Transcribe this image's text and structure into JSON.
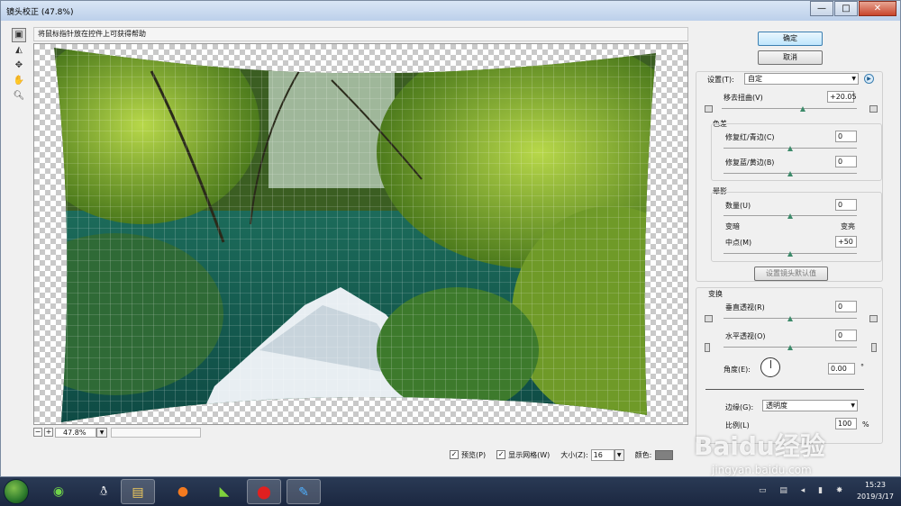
{
  "window": {
    "title": "镜头校正 (47.8%)",
    "min": "—",
    "max": "□",
    "close": "✕"
  },
  "hint": "将鼠标指针放在控件上可获得帮助",
  "tools": [
    "distortion-tool-icon",
    "straighten-icon",
    "move-grid-icon",
    "hand-icon",
    "zoom-icon"
  ],
  "zoom": {
    "minus": "−",
    "plus": "+",
    "value": "47.8%"
  },
  "options": {
    "preview": "预览(P)",
    "show_grid": "显示网格(W)",
    "size_label": "大小(Z):",
    "size_value": "16",
    "color_label": "颜色:"
  },
  "buttons": {
    "ok": "确定",
    "cancel": "取消",
    "set_default": "设置镜头默认值"
  },
  "settings": {
    "label": "设置(T):",
    "value": "自定"
  },
  "distortion": {
    "label": "移去扭曲(V)",
    "value": "+20.05"
  },
  "chromatic": {
    "title": "色差",
    "red_cyan_label": "修复红/青边(C)",
    "red_cyan_value": "0",
    "blue_yellow_label": "修复蓝/黄边(B)",
    "blue_yellow_value": "0"
  },
  "vignette": {
    "title": "晕影",
    "amount_label": "数量(U)",
    "amount_value": "0",
    "darken": "变暗",
    "lighten": "变亮",
    "midpoint_label": "中点(M)",
    "midpoint_value": "+50"
  },
  "transform": {
    "title": "变换",
    "vertical_label": "垂直透视(R)",
    "vertical_value": "0",
    "horizontal_label": "水平透视(O)",
    "horizontal_value": "0",
    "angle_label": "角度(E):",
    "angle_value": "0.00",
    "angle_unit": "°",
    "edge_label": "边缘(G):",
    "edge_value": "透明度",
    "scale_label": "比例(L)",
    "scale_value": "100",
    "scale_unit": "%"
  },
  "slider_levels": {
    "distortion": 0.6,
    "red_cyan": 0.5,
    "blue_yellow": 0.5,
    "amount": 0.5,
    "midpoint": 0.5,
    "vertical": 0.5,
    "horizontal": 0.5
  },
  "taskbar": {
    "apps": [
      "browser-360-icon",
      "qq-icon",
      "explorer-icon",
      "firefox-icon",
      "media-icon",
      "recorder-icon",
      "photoshop-icon"
    ],
    "time": "15:23",
    "date": "2019/3/17"
  },
  "watermark": {
    "brand": "Baidu经验",
    "url": "jingyan.baidu.com"
  }
}
